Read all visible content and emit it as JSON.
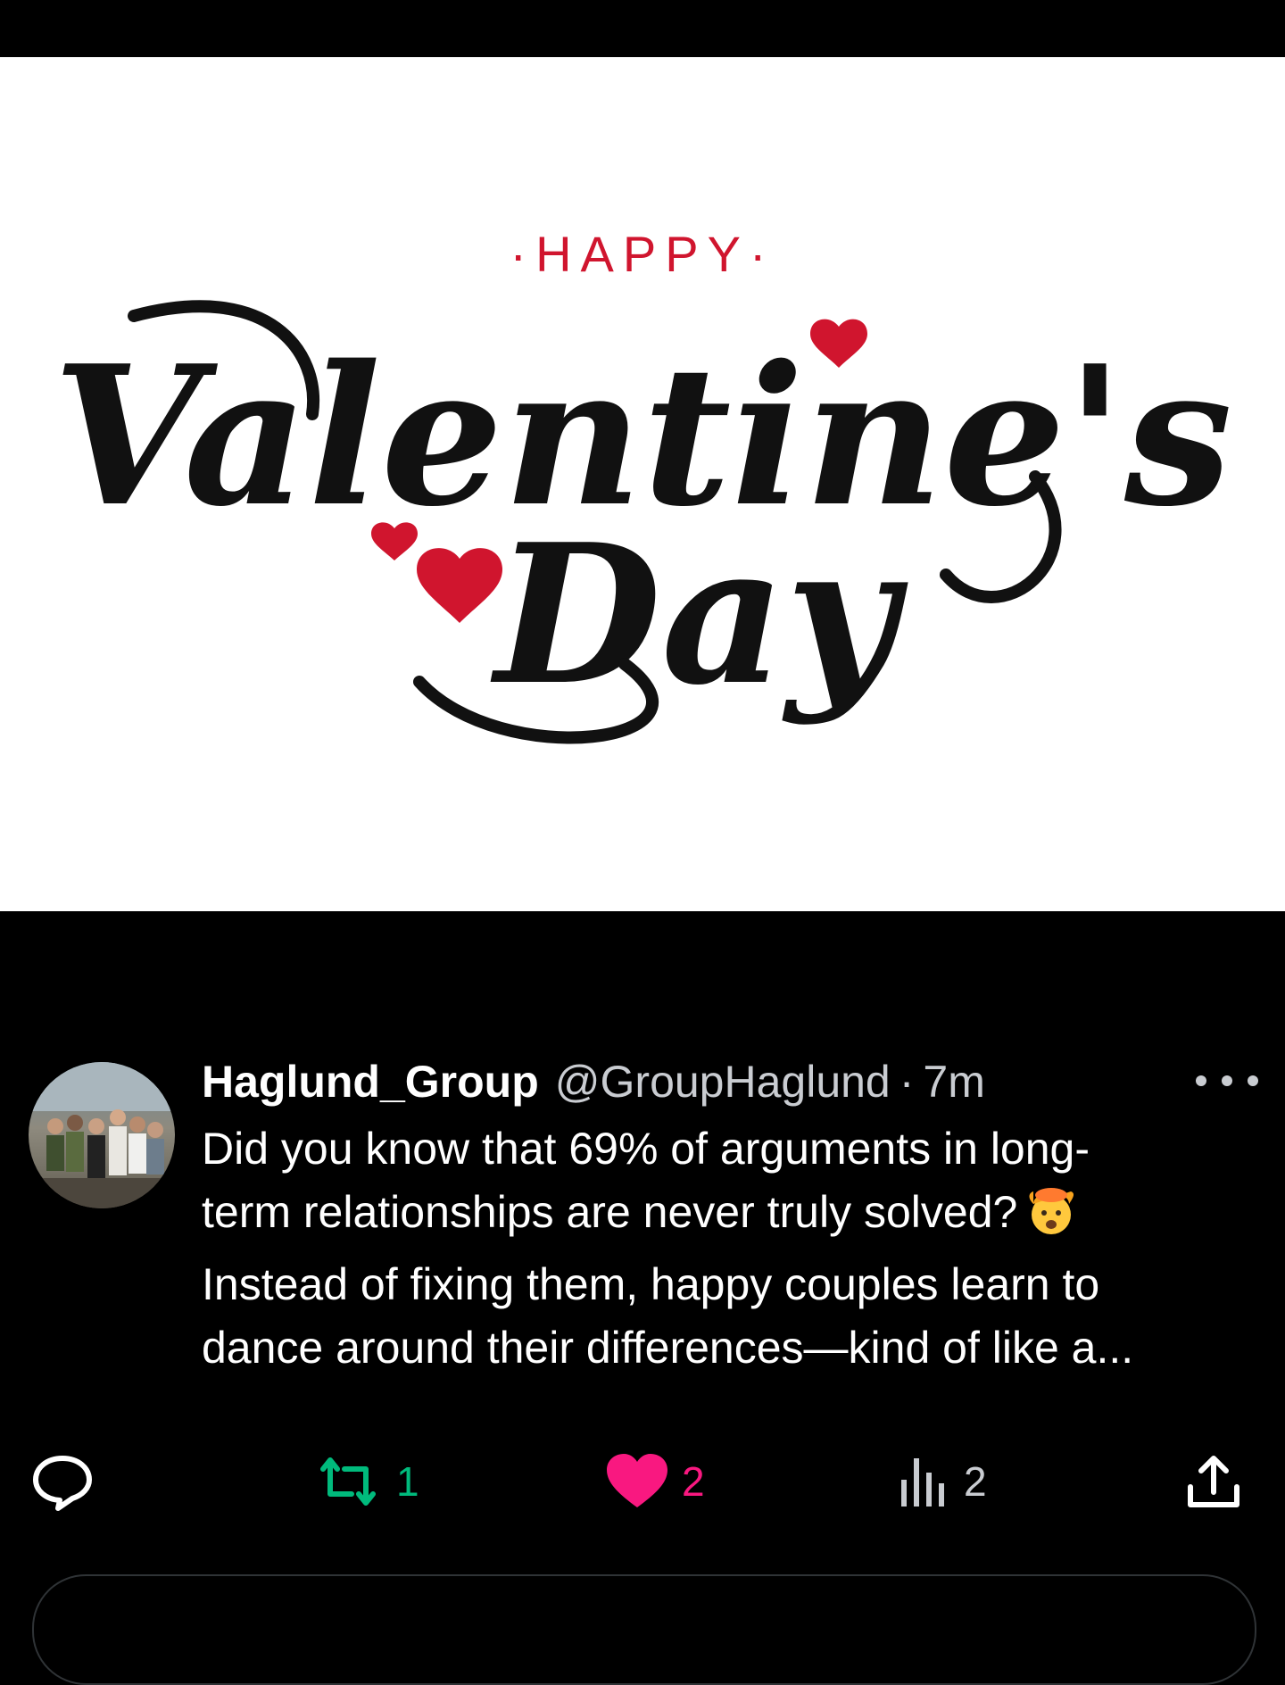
{
  "media": {
    "graphic_text": {
      "happy": "·HAPPY·",
      "valentines": "Valentine's",
      "day": "Day"
    },
    "colors": {
      "background": "#ffffff",
      "script": "#111111",
      "accent": "#d0152e"
    }
  },
  "post": {
    "avatar_alt": "group photo",
    "display_name": "Haglund_Group",
    "handle": "@GroupHaglund",
    "separator": "·",
    "time": "7m",
    "text_lines": [
      "Did you know that 69% of arguments in long-",
      "term relationships are never truly solved?",
      "Instead of fixing them, happy couples learn to",
      "dance around their differences—kind of like a..."
    ],
    "emoji": "exploding-head-emoji",
    "actions": {
      "reply": {
        "icon": "reply-bubble-icon",
        "count": ""
      },
      "repost": {
        "icon": "repost-icon",
        "count": "1",
        "color": "#00ba7c"
      },
      "like": {
        "icon": "heart-icon",
        "count": "2",
        "color": "#f91880"
      },
      "views": {
        "icon": "views-bar-chart-icon",
        "count": "2"
      },
      "share": {
        "icon": "share-upload-icon",
        "count": ""
      }
    }
  }
}
